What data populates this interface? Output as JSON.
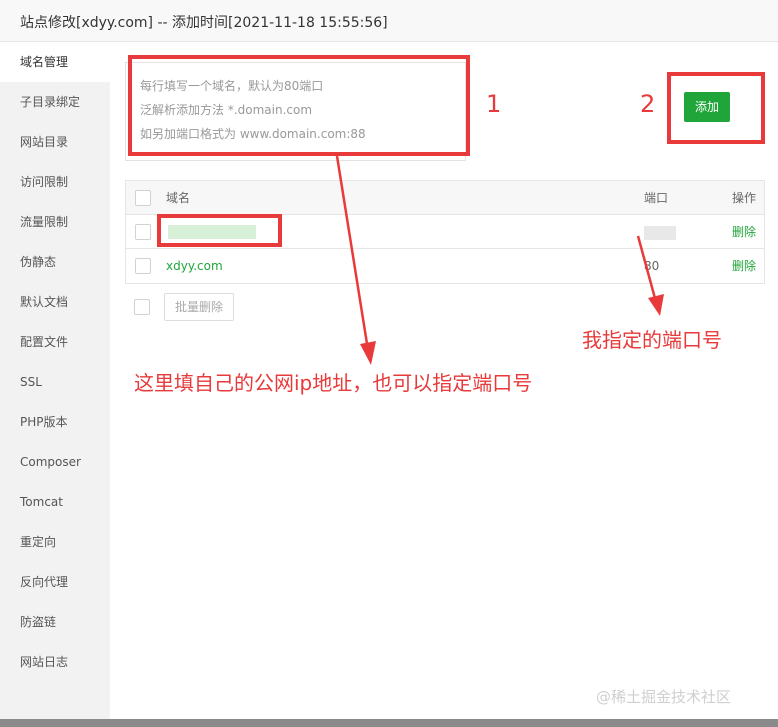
{
  "window": {
    "title": "站点修改[xdyy.com] -- 添加时间[2021-11-18 15:55:56]"
  },
  "sidebar": {
    "items": [
      {
        "label": "域名管理"
      },
      {
        "label": "子目录绑定"
      },
      {
        "label": "网站目录"
      },
      {
        "label": "访问限制"
      },
      {
        "label": "流量限制"
      },
      {
        "label": "伪静态"
      },
      {
        "label": "默认文档"
      },
      {
        "label": "配置文件"
      },
      {
        "label": "SSL"
      },
      {
        "label": "PHP版本"
      },
      {
        "label": "Composer"
      },
      {
        "label": "Tomcat"
      },
      {
        "label": "重定向"
      },
      {
        "label": "反向代理"
      },
      {
        "label": "防盗链"
      },
      {
        "label": "网站日志"
      }
    ],
    "active": "域名管理"
  },
  "domain_input": {
    "hints": [
      "每行填写一个域名，默认为80端口",
      "泛解析添加方法 *.domain.com",
      "如另加端口格式为 www.domain.com:88"
    ]
  },
  "add_button": {
    "label": "添加"
  },
  "table": {
    "headers": {
      "domain": "域名",
      "port": "端口",
      "action": "操作"
    },
    "rows": [
      {
        "domain": "",
        "port": "",
        "action": "删除"
      },
      {
        "domain": "xdyy.com",
        "port": "80",
        "action": "删除"
      }
    ]
  },
  "batch_delete": {
    "label": "批量删除"
  },
  "annotations": {
    "label_1": "1",
    "label_2": "2",
    "port_note": "我指定的端口号",
    "ip_note": "这里填自己的公网ip地址，也可以指定端口号",
    "color": "#e83a3a"
  },
  "watermark": "@稀土掘金技术社区",
  "colors": {
    "accent": "#20a53a"
  }
}
